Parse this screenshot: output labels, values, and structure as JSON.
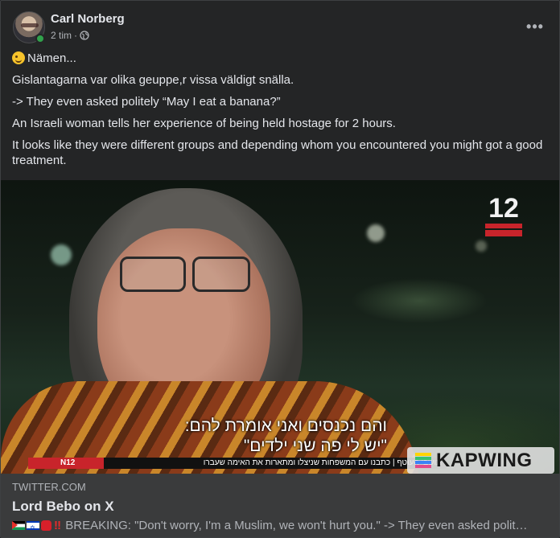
{
  "post": {
    "author": "Carl Norberg",
    "time": "2 tim",
    "separator": "·",
    "privacy_icon": "globe-icon",
    "more_icon": "ellipsis-icon",
    "more_label": "•••",
    "paragraphs": {
      "p0": "Nämen...",
      "p1": "Gislantagarna var olika geuppe,r vissa väldigt snälla.",
      "p2": "-> They even asked politely “May I eat a banana?”",
      "p3": "An Israeli woman tells her experience of being held hostage for 2 hours.",
      "p4": "It looks like they were different groups and depending whom you encountered you might got a good treatment."
    }
  },
  "media": {
    "channel_number": "12",
    "subtitle_line1": "והם נכנסים ואני אומרת להם:",
    "subtitle_line2": "\"יש לי פה שני ילדים\"",
    "ticker_badge": "N12",
    "ticker_text": "תושבי העוטף | כתבנו עם המשפחות שניצלו ומתארות את האימה שעברו",
    "watermark": "KAPWING"
  },
  "link_preview": {
    "domain": "TWITTER.COM",
    "title": "Lord Bebo on X",
    "description": "BREAKING: \"Don't worry, I'm a Muslim, we won't hurt you.\" -> They even asked polit…",
    "alert_glyph": "‼"
  },
  "colors": {
    "background": "#242526",
    "text_primary": "#e4e6eb",
    "text_secondary": "#b0b3b8",
    "card": "#3a3b3c",
    "online": "#31a24c",
    "channel_red": "#c8242b"
  }
}
